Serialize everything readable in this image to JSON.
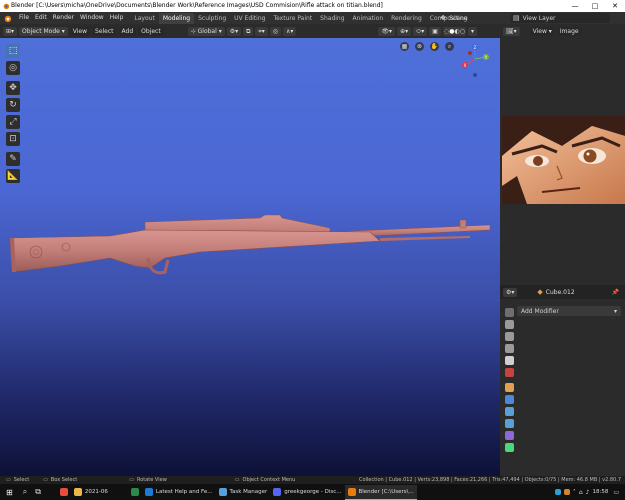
{
  "window": {
    "title": "Blender [C:\\Users\\micha\\OneDrive\\Documents\\Blender Work\\Reference Images\\USD Commision\\Rifle attack on titian.blend]",
    "minimize": "—",
    "maximize": "□",
    "close": "✕"
  },
  "menu": {
    "items": [
      "File",
      "Edit",
      "Render",
      "Window",
      "Help"
    ]
  },
  "workspaces": {
    "tabs": [
      "Layout",
      "Modeling",
      "Sculpting",
      "UV Editing",
      "Texture Paint",
      "Shading",
      "Animation",
      "Rendering",
      "Compositing"
    ],
    "active": "Modeling"
  },
  "scene": {
    "label": "Scene",
    "view_layer": "View Layer"
  },
  "viewport_header": {
    "mode": "Object Mode",
    "menus": [
      "View",
      "Select",
      "Add",
      "Object"
    ],
    "orientation": "Global"
  },
  "gizmo": {
    "z": "Z",
    "y": "Y",
    "x": "X"
  },
  "image_editor": {
    "menus": [
      "View",
      "Image"
    ]
  },
  "properties": {
    "object_name": "Cube.012",
    "add_modifier": "Add Modifier"
  },
  "statusbar": {
    "select": "Select",
    "box_select": "Box Select",
    "rotate_view": "Rotate View",
    "context_menu": "Object Context Menu",
    "stats": "Collection | Cube.012 | Verts:23,898 | Faces:21,266 | Tris:47,494 | Objects:0/75 | Mem: 46.8 MB | v2.80.7"
  },
  "taskbar": {
    "apps": [
      {
        "label": "2021-06",
        "color": "#e8b84a"
      },
      {
        "label": "Latest Help and Fe...",
        "color": "#1e7bd6"
      },
      {
        "label": "Task Manager",
        "color": "#5aa0d8"
      },
      {
        "label": "greekgeorge - Disc...",
        "color": "#5865f2"
      },
      {
        "label": "Blender [C:\\Users\\...",
        "color": "#e87d0d"
      }
    ],
    "clock": "18:58"
  },
  "colors": {
    "accent": "#4772b3",
    "rifle": "#c27d78",
    "viewport_top": "#4f6fd9",
    "viewport_bottom": "#0d1136"
  }
}
